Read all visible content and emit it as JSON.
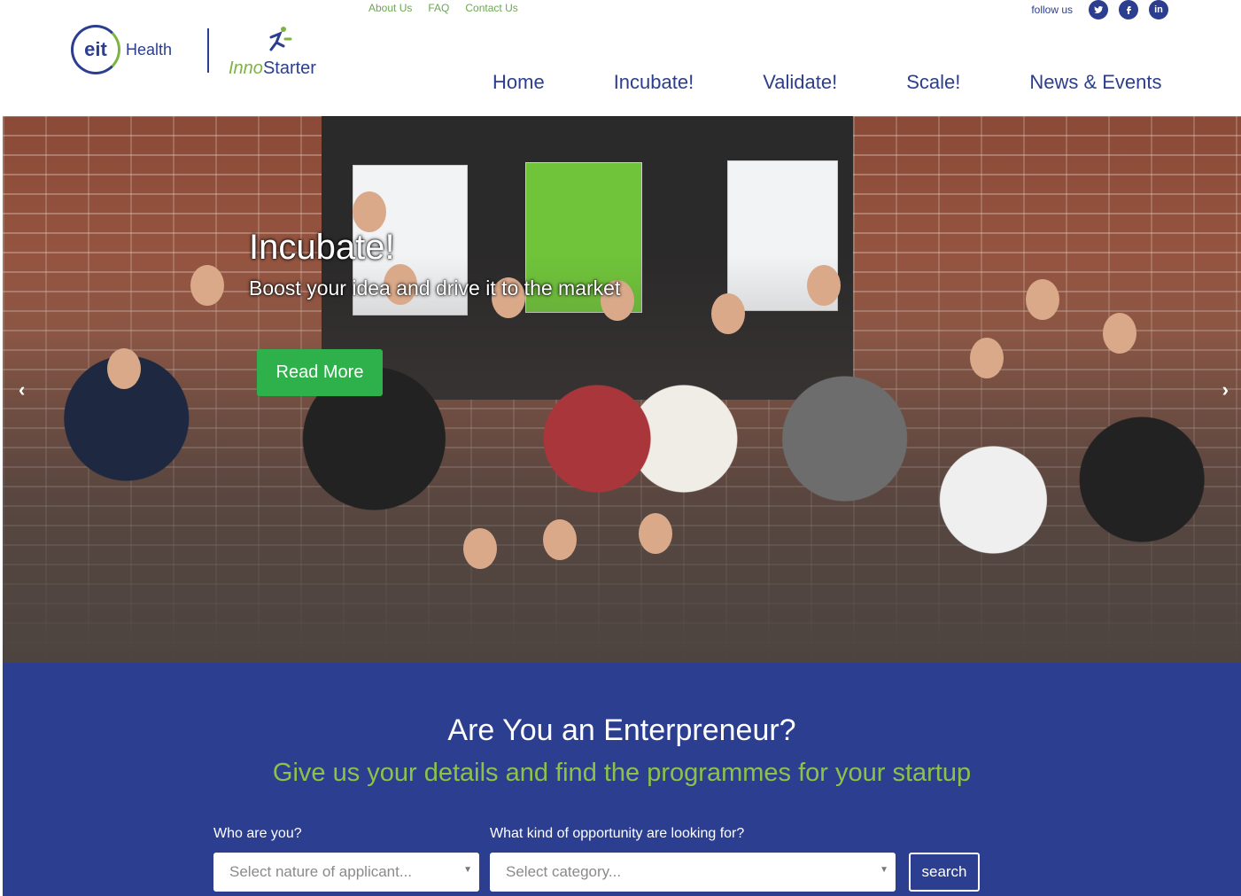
{
  "header": {
    "top_links": [
      "About Us",
      "FAQ",
      "Contact Us"
    ],
    "follow_label": "follow us",
    "social": [
      "twitter-icon",
      "facebook-icon",
      "linkedin-icon"
    ],
    "logo_eit": "eit",
    "logo_health": "Health",
    "logo_inno_prefix": "Inno",
    "logo_inno_suffix": "Starter",
    "nav": [
      "Home",
      "Incubate!",
      "Validate!",
      "Scale!",
      "News & Events"
    ]
  },
  "hero": {
    "title": "Incubate!",
    "subtitle": "Boost your idea and drive it to the market",
    "button": "Read More",
    "prev_arrow": "‹",
    "next_arrow": "›"
  },
  "cta": {
    "title": "Are You an Enterpreneur?",
    "subtitle": "Give us your details and find the programmes for your startup",
    "who_label": "Who are you?",
    "who_placeholder": "Select nature of applicant...",
    "what_label": "What kind of opportunity are looking for?",
    "what_placeholder": "Select category...",
    "search": "search"
  },
  "colors": {
    "brand_blue": "#2b3e8f",
    "brand_green": "#7cb342",
    "button_green": "#2eb14a"
  }
}
